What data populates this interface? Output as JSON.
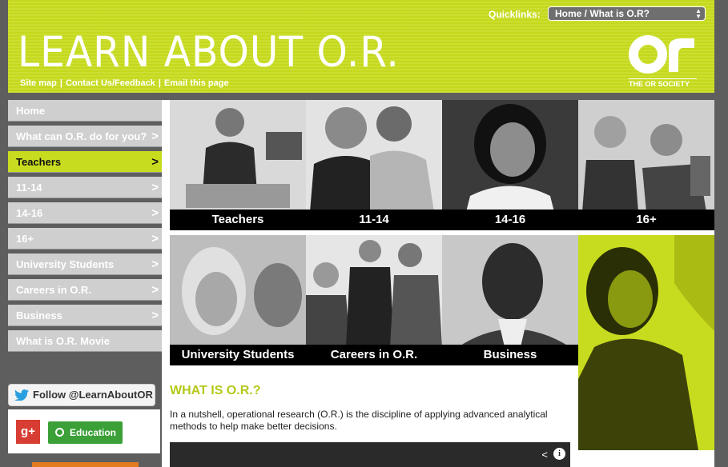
{
  "header": {
    "quicklinks_label": "Quicklinks:",
    "quicklinks_selected": "Home / What is O.R?",
    "title": "LEARN ABOUT O.R.",
    "links": [
      "Site map",
      "Contact Us/Feedback",
      "Email this page"
    ],
    "separator": "|",
    "logo_mark": "OR",
    "logo_text": "THE OR SOCIETY"
  },
  "sidebar": {
    "items": [
      {
        "label": "Home",
        "chev": ""
      },
      {
        "label": "What can O.R. do for you?",
        "chev": ">"
      },
      {
        "label": "Teachers",
        "chev": ">"
      },
      {
        "label": "11-14",
        "chev": ">"
      },
      {
        "label": "14-16",
        "chev": ">"
      },
      {
        "label": "16+",
        "chev": ">"
      },
      {
        "label": "University Students",
        "chev": ">"
      },
      {
        "label": "Careers in O.R.",
        "chev": ">"
      },
      {
        "label": "Business",
        "chev": ">"
      },
      {
        "label": "What is O.R. Movie",
        "chev": ""
      }
    ],
    "active": "Teachers",
    "twitter_label": "Follow @LearnAboutOR",
    "gplus_label": "g+",
    "education_label": "Education"
  },
  "tiles": [
    {
      "caption": "Teachers"
    },
    {
      "caption": "11-14"
    },
    {
      "caption": "14-16"
    },
    {
      "caption": "16+"
    },
    {
      "caption": "University Students"
    },
    {
      "caption": "Careers in O.R."
    },
    {
      "caption": "Business"
    }
  ],
  "content": {
    "heading": "WHAT IS O.R.?",
    "intro": "In a nutshell, operational research (O.R.) is the discipline of applying advanced analytical methods to help make better decisions.",
    "video_share_icon": "share-icon",
    "video_info_label": "i"
  },
  "colors": {
    "accent": "#c8dc1f",
    "sidebar_bg": "#cfcfcf",
    "page_bg": "#5e5e5e",
    "caption_bg": "#000000",
    "education_green": "#3aa037",
    "gplus_red": "#d73d32"
  }
}
